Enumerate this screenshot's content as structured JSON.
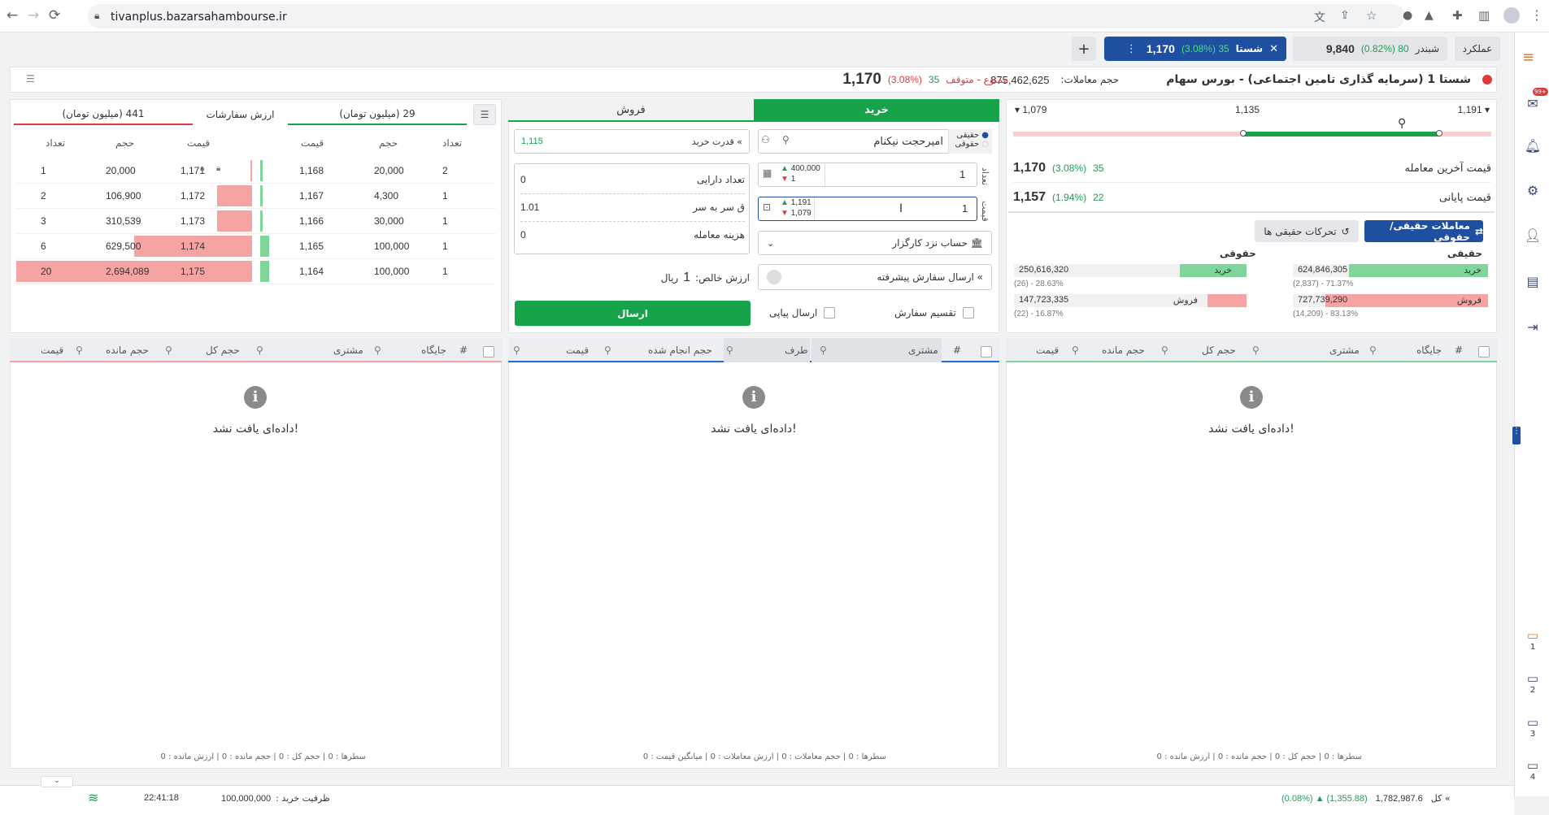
{
  "browser": {
    "url": "tivanplus.bazarsahambourse.ir"
  },
  "topbar": {
    "performance": "عملکرد",
    "tab1": {
      "name": "شبندر",
      "change": "80 (0.82%)",
      "price": "9,840"
    },
    "tab2": {
      "name": "شستا",
      "change": "35 (3.08%)",
      "price": "1,170"
    },
    "add": "+"
  },
  "symbol": {
    "title": "شستا 1 (سرمایه گذاری تامین اجتماعی) - بورس سهام",
    "volume_label": "حجم معاملات:",
    "volume": "875,462,625",
    "status": "ممنوع - متوقف",
    "change": "35",
    "percent": "(3.08%)",
    "price": "1,170"
  },
  "range": {
    "low": "1,079",
    "mid": "1,135",
    "high": "1,191"
  },
  "last_trade": {
    "label": "قیمت آخرین معامله",
    "price": "1,170",
    "percent": "(3.08%)",
    "change": "35"
  },
  "closing": {
    "label": "قیمت پایانی",
    "price": "1,157",
    "percent": "(1.94%)",
    "change": "22"
  },
  "buttons": {
    "real_legal": "معاملات حقیقی/حقوقی",
    "real_moves": "تحرکات حقیقی ها"
  },
  "real_legal": {
    "real_title": "حقیقی",
    "legal_title": "حقوقی",
    "buy": "خرید",
    "sell": "فروش",
    "real_buy": "624,846,305",
    "real_buy_sub": "(2,837) - 71.37%",
    "real_sell": "727,739,290",
    "real_sell_sub": "(14,209) - 83.13%",
    "legal_buy": "250,616,320",
    "legal_buy_sub": "(26) - 28.63%",
    "legal_sell": "147,723,335",
    "legal_sell_sub": "(22) - 16.87%"
  },
  "order": {
    "tab_buy": "خرید",
    "tab_sell": "فروش",
    "real": "حقیقی",
    "legal": "حقوقی",
    "customer": "امیرحجت نیکنام",
    "buying_power_label": "قدرت خرید",
    "buying_power": "1,115",
    "qty": "1",
    "qty_max": "400,000",
    "qty_min": "1",
    "price": "1",
    "price_max": "1,191",
    "price_min": "1,079",
    "assets_label": "تعداد دارایی",
    "assets": "0",
    "breakeven_label": "ق سر به سر",
    "breakeven": "1.01",
    "cost_label": "هزینه معامله",
    "cost": "0",
    "broker_account": "حساب نزد کارگزار",
    "net_label": "ارزش خالص:",
    "net_value": "1",
    "net_unit": "ریال",
    "advanced": "ارسال سفارش پیشرفته",
    "split": "تقسیم سفارش",
    "stepwise": "ارسال پیاپی",
    "send": "ارسال",
    "qty_label": "تعداد",
    "price_label": "قیمت"
  },
  "orderbook": {
    "tab_value": "ارزش سفارشات",
    "buy_value": "441 (میلیون تومان)",
    "sell_value": "29 (میلیون تومان)",
    "headers": {
      "count": "تعداد",
      "volume": "حجم",
      "price": "قیمت"
    },
    "rows": [
      {
        "sc": "1",
        "sv": "20,000",
        "sp": "1,171",
        "bp": "1,168",
        "bv": "20,000",
        "bc": "2",
        "sw": 0.01,
        "bw": 0.01
      },
      {
        "sc": "2",
        "sv": "106,900",
        "sp": "1,172",
        "bp": "1,167",
        "bv": "4,300",
        "bc": "1",
        "sw": 0.15,
        "bw": 0.01
      },
      {
        "sc": "3",
        "sv": "310,539",
        "sp": "1,173",
        "bp": "1,166",
        "bv": "30,000",
        "bc": "1",
        "sw": 0.15,
        "bw": 0.01
      },
      {
        "sc": "6",
        "sv": "629,500",
        "sp": "1,174",
        "bp": "1,165",
        "bv": "100,000",
        "bc": "1",
        "sw": 0.5,
        "bw": 0.04
      },
      {
        "sc": "20",
        "sv": "2,694,089",
        "sp": "1,175",
        "bp": "1,164",
        "bv": "100,000",
        "bc": "1",
        "sw": 1.0,
        "bw": 0.04
      }
    ]
  },
  "tables": {
    "left": {
      "cols": [
        "قیمت",
        "حجم مانده",
        "حجم کل",
        "مشتری",
        "جایگاه",
        "#"
      ],
      "footer": "سطرها : 0 | حجم کل : 0 | حجم مانده : 0 | ارزش مانده : 0"
    },
    "mid": {
      "cols": [
        "قیمت",
        "حجم انجام شده",
        "طرف",
        "مشتری",
        "#"
      ],
      "footer": "سطرها : 0 | حجم معاملات : 0 | ارزش معاملات : 0 | میانگین قیمت : 0"
    },
    "right": {
      "cols": [
        "قیمت",
        "حجم مانده",
        "حجم کل",
        "مشتری",
        "جایگاه",
        "#"
      ],
      "footer": "سطرها : 0 | حجم کل : 0 | حجم مانده : 0 | ارزش مانده : 0"
    },
    "empty": "داده‌ای یافت نشد!"
  },
  "status": {
    "time": "22:41:18",
    "capacity_label": "ظرفیت خرید :",
    "capacity": "100,000,000",
    "index_label": "کل",
    "index": "1,782,987.6",
    "index_change": "(0.08%) ▲ (1,355.88)"
  },
  "side_badge": "99+",
  "monitors": [
    "1",
    "2",
    "3",
    "4"
  ],
  "colors": {
    "buy": "#16a34a",
    "sell": "#f6a3a3",
    "accent": "#1e4fa0"
  }
}
